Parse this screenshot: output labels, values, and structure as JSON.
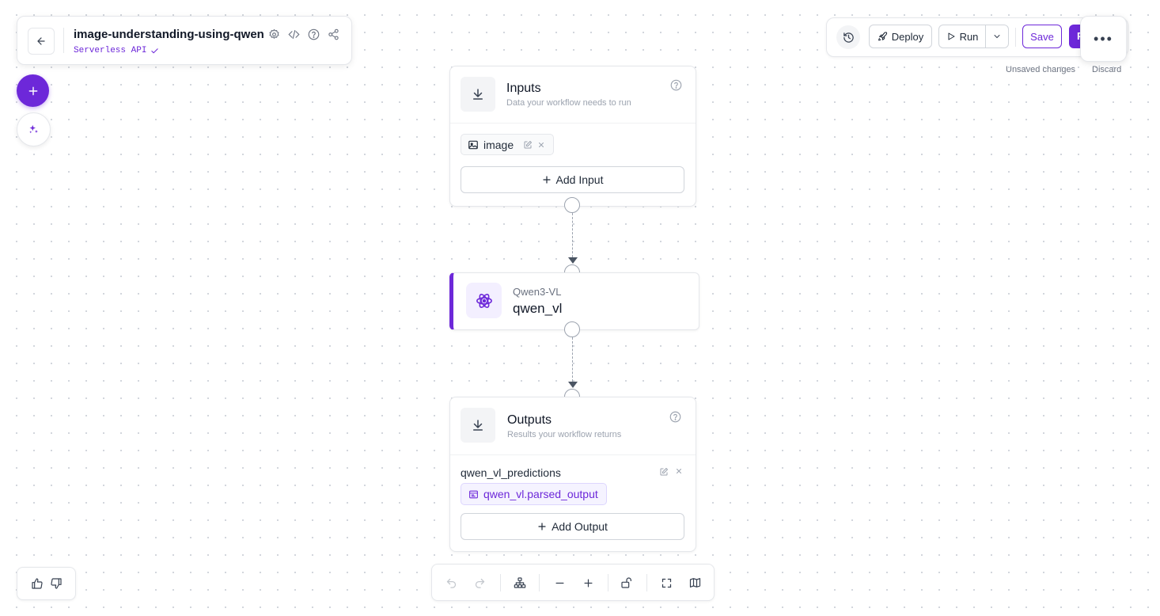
{
  "workflow": {
    "title": "image-understanding-using-qwen",
    "subtitle": "Serverless API",
    "subtitle_check_icon": "check-icon"
  },
  "header_icons": [
    "settings-icon",
    "code-icon",
    "help-icon",
    "share-icon"
  ],
  "toolbar": {
    "deploy_label": "Deploy",
    "run_label": "Run",
    "save_label": "Save",
    "publish_label": "Publish",
    "more_label": "•••",
    "unsaved_label": "Unsaved changes",
    "discard_label": "Discard"
  },
  "inputs_node": {
    "title": "Inputs",
    "description": "Data your workflow needs to run",
    "inputs": [
      {
        "name": "image",
        "icon": "image-icon"
      }
    ],
    "add_label": "Add Input"
  },
  "model_node": {
    "type": "Qwen3-VL",
    "name": "qwen_vl",
    "icon": "atom-icon"
  },
  "outputs_node": {
    "title": "Outputs",
    "description": "Results your workflow returns",
    "output_name": "qwen_vl_predictions",
    "output_value": "qwen_vl.parsed_output",
    "add_label": "Add Output"
  },
  "colors": {
    "accent": "#6d28d9",
    "accent_light": "#f3efff",
    "border": "#e5e7eb",
    "canvas_dots": "#cfd3da"
  }
}
